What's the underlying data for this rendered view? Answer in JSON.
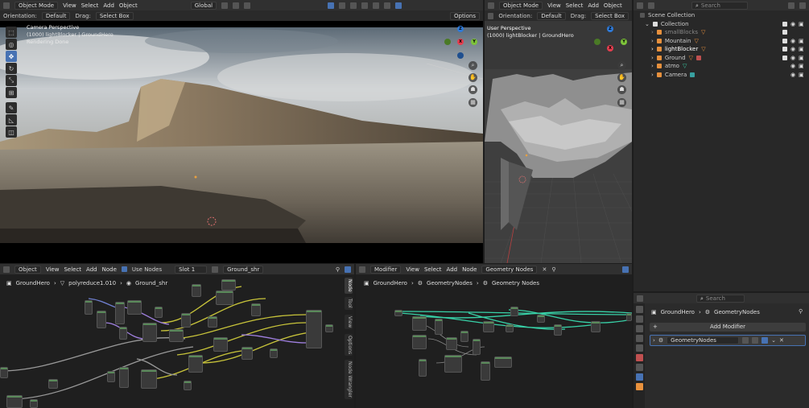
{
  "topbar": {
    "mode": "Object Mode",
    "menus": [
      "View",
      "Select",
      "Add",
      "Object"
    ],
    "orientation_label": "Orientation:",
    "orientation_value": "Default",
    "drag_label": "Drag:",
    "drag_value": "Select Box",
    "transform_orientation": "Global",
    "options_label": "Options",
    "search_placeholder": "Search"
  },
  "viewport_left": {
    "title": "Camera Perspective",
    "subtitle": "(1000) lightBlocker | GroundHero",
    "status": "Rendering Done"
  },
  "viewport_right": {
    "mode": "Object Mode",
    "menus": [
      "View",
      "Select",
      "Add",
      "Object"
    ],
    "orientation_label": "Orientation:",
    "orientation_value": "Default",
    "drag_label": "Drag:",
    "drag_value": "Select Box",
    "title": "User Perspective",
    "subtitle": "(1000) lightBlocker | GroundHero"
  },
  "axes": {
    "x": "X",
    "y": "Y",
    "z": "Z"
  },
  "outliner": {
    "root": "Scene Collection",
    "collection": "Collection",
    "items": [
      {
        "name": "smallBlocks",
        "dim": true
      },
      {
        "name": "Mountain",
        "dim": false
      },
      {
        "name": "lightBlocker",
        "dim": false
      },
      {
        "name": "Ground",
        "dim": false
      },
      {
        "name": "atmo",
        "dim": false
      },
      {
        "name": "Camera",
        "dim": false
      }
    ]
  },
  "node_editor_left": {
    "type": "Object",
    "menus": [
      "View",
      "Select",
      "Add",
      "Node"
    ],
    "use_nodes_label": "Use Nodes",
    "slot": "Slot 1",
    "material": "Ground_shr",
    "breadcrumb": [
      "GroundHero",
      "polyreduce1.010",
      "Ground_shr"
    ],
    "side_tabs": [
      "Node",
      "Tool",
      "View",
      "Options",
      "Node Wrangler"
    ]
  },
  "node_editor_right": {
    "type": "Modifier",
    "menus": [
      "View",
      "Select",
      "Add",
      "Node"
    ],
    "tree": "Geometry Nodes",
    "breadcrumb": [
      "GroundHero",
      "GeometryNodes",
      "Geometry Nodes"
    ]
  },
  "properties": {
    "search_placeholder": "Search",
    "breadcrumb": [
      "GroundHero",
      "GeometryNodes"
    ],
    "add_modifier": "Add Modifier",
    "modifier_name": "GeometryNodes"
  },
  "colors": {
    "accent": "#4772b3",
    "panel": "#303030",
    "background": "#1d1d1d",
    "axis_x": "#e53e4f",
    "axis_y": "#7dc33a",
    "axis_z": "#2f7ad8",
    "geo_link": "#38d2a8",
    "shader_link": "#c8c43a"
  }
}
